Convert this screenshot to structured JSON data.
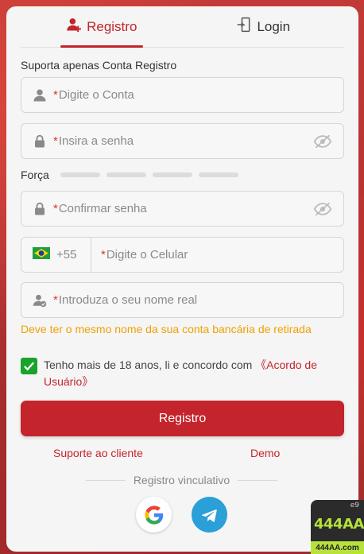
{
  "tabs": [
    {
      "label": "Registro",
      "icon": "add-user-icon",
      "active": true
    },
    {
      "label": "Login",
      "icon": "login-door-icon",
      "active": false
    }
  ],
  "form": {
    "section_label": "Suporta apenas Conta Registro",
    "required_mark": "*",
    "account_placeholder": "Digite o Conta",
    "password_placeholder": "Insira a senha",
    "strength_label": "Força",
    "confirm_placeholder": "Confirmar senha",
    "phone_prefix": "+55",
    "phone_placeholder": "Digite o Celular",
    "name_placeholder": "Introduza o seu nome real",
    "name_hint": "Deve ter o mesmo nome da sua conta bancária de retirada",
    "agreement_text": "Tenho mais de 18 anos, li e concordo com ",
    "agreement_link": "《Acordo de Usuário》",
    "agreement_checked": true,
    "submit_label": "Registro"
  },
  "links": {
    "support": "Suporte ao cliente",
    "demo": "Demo"
  },
  "social": {
    "label": "Registro vinculativo",
    "providers": [
      "google-icon",
      "telegram-icon"
    ]
  },
  "badge": {
    "number": "e9",
    "title": "444AA",
    "url": "444AA.com"
  },
  "colors": {
    "accent": "#c4242b",
    "hint": "#f0a000",
    "check": "#1aa32a"
  }
}
